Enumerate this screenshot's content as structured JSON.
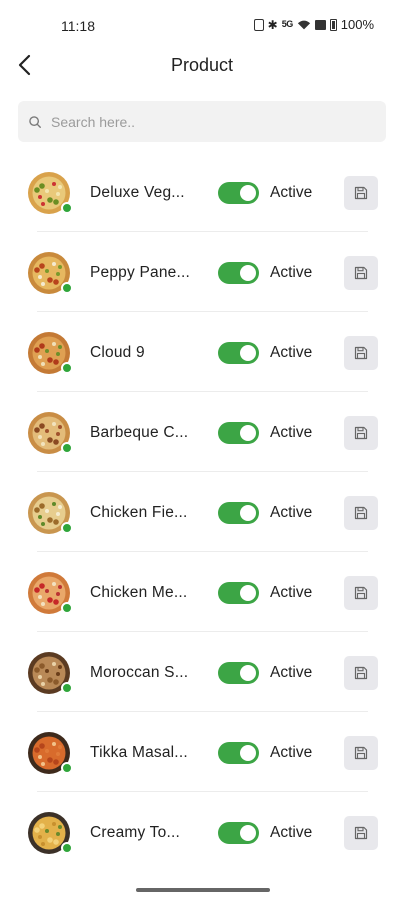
{
  "status_bar": {
    "time": "11:18",
    "battery": "100%",
    "signal_text": "5G",
    "icons": [
      "vibrate-icon",
      "bluetooth-icon",
      "signal-icon",
      "wifi-icon",
      "nfc-icon",
      "battery-icon"
    ]
  },
  "header": {
    "title": "Product",
    "back_icon": "chevron-left-icon"
  },
  "search": {
    "placeholder": "Search here..",
    "value": "",
    "icon": "search-icon"
  },
  "colors": {
    "accent_green": "#3ca545",
    "online_dot": "#2fa53a",
    "save_button_bg": "#e8e8ec"
  },
  "products": [
    {
      "name": "Deluxe Veg...",
      "status": "Active",
      "image": "veg-pizza",
      "online": true
    },
    {
      "name": "Peppy Pane...",
      "status": "Active",
      "image": "paneer-pizza",
      "online": true
    },
    {
      "name": "Cloud 9",
      "status": "Active",
      "image": "cloud-pizza",
      "online": true
    },
    {
      "name": "Barbeque C...",
      "status": "Active",
      "image": "bbq-pizza",
      "online": true
    },
    {
      "name": "Chicken Fie...",
      "status": "Active",
      "image": "chicken-pizza",
      "online": true
    },
    {
      "name": "Chicken Me...",
      "status": "Active",
      "image": "pepperoni-pizza",
      "online": true
    },
    {
      "name": "Moroccan S...",
      "status": "Active",
      "image": "moroccan-dish",
      "online": true
    },
    {
      "name": "Tikka Masal...",
      "status": "Active",
      "image": "tikka-pasta",
      "online": true
    },
    {
      "name": "Creamy To...",
      "status": "Active",
      "image": "creamy-pasta",
      "online": true
    }
  ]
}
